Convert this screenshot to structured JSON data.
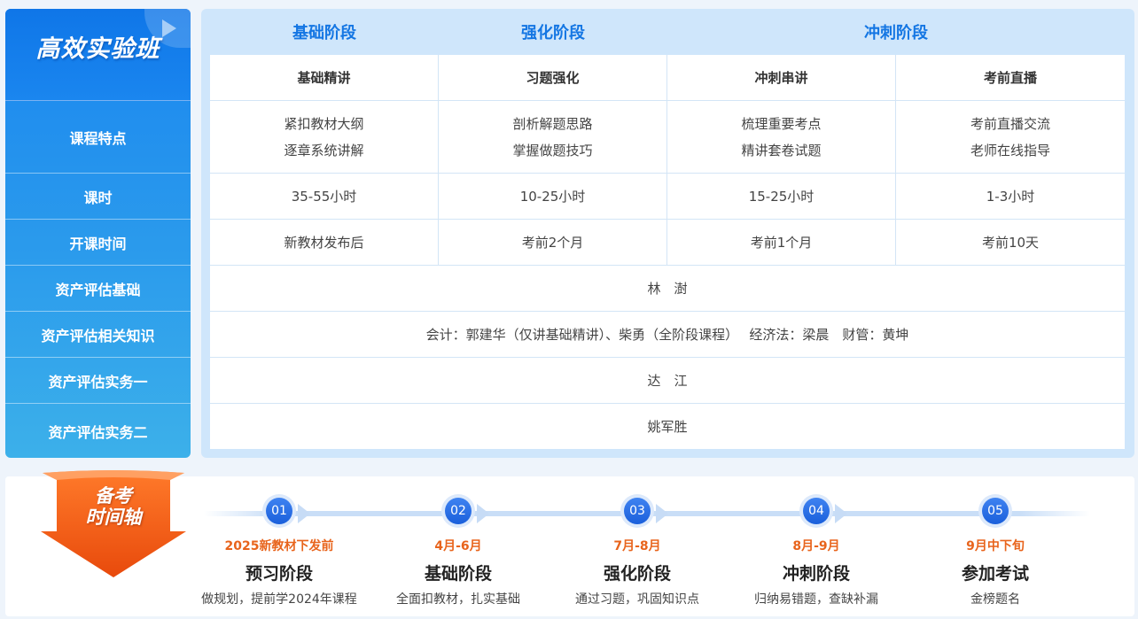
{
  "side": {
    "title": "高效实验班",
    "rows": [
      "课程特点",
      "课时",
      "开课时间",
      "资产评估基础",
      "资产评估相关知识",
      "资产评估实务一",
      "资产评估实务二"
    ]
  },
  "table": {
    "phase_headers": [
      "基础阶段",
      "强化阶段",
      "冲刺阶段"
    ],
    "columns": [
      "基础精讲",
      "习题强化",
      "冲刺串讲",
      "考前直播"
    ],
    "features": [
      [
        "紧扣教材大纲",
        "逐章系统讲解"
      ],
      [
        "剖析解题思路",
        "掌握做题技巧"
      ],
      [
        "梳理重要考点",
        "精讲套卷试题"
      ],
      [
        "考前直播交流",
        "老师在线指导"
      ]
    ],
    "hours": [
      "35-55小时",
      "10-25小时",
      "15-25小时",
      "1-3小时"
    ],
    "start_time": [
      "新教材发布后",
      "考前2个月",
      "考前1个月",
      "考前10天"
    ],
    "teachers": [
      "林　澍",
      "会计：郭建华（仅讲基础精讲）、柴勇（全阶段课程）　 经济法：梁晨　财管：黄坤",
      "达　江",
      "姚军胜"
    ]
  },
  "timeline": {
    "badge": [
      "备考",
      "时间轴"
    ],
    "steps": [
      {
        "num": "01",
        "date": "2025新教材下发前",
        "title": "预习阶段",
        "desc": "做规划，提前学2024年课程"
      },
      {
        "num": "02",
        "date": "4月-6月",
        "title": "基础阶段",
        "desc": "全面扣教材，扎实基础"
      },
      {
        "num": "03",
        "date": "7月-8月",
        "title": "强化阶段",
        "desc": "通过习题，巩固知识点"
      },
      {
        "num": "04",
        "date": "8月-9月",
        "title": "冲刺阶段",
        "desc": "归纳易错题，查缺补漏"
      },
      {
        "num": "05",
        "date": "9月中下旬",
        "title": "参加考试",
        "desc": "金榜题名"
      }
    ]
  },
  "colors": {
    "accent_blue": "#1476e3",
    "side_blue": "#1a86ef",
    "panel_bg": "#cfe6fb",
    "date_orange": "#e8641c",
    "badge_orange": "#f05a14"
  }
}
